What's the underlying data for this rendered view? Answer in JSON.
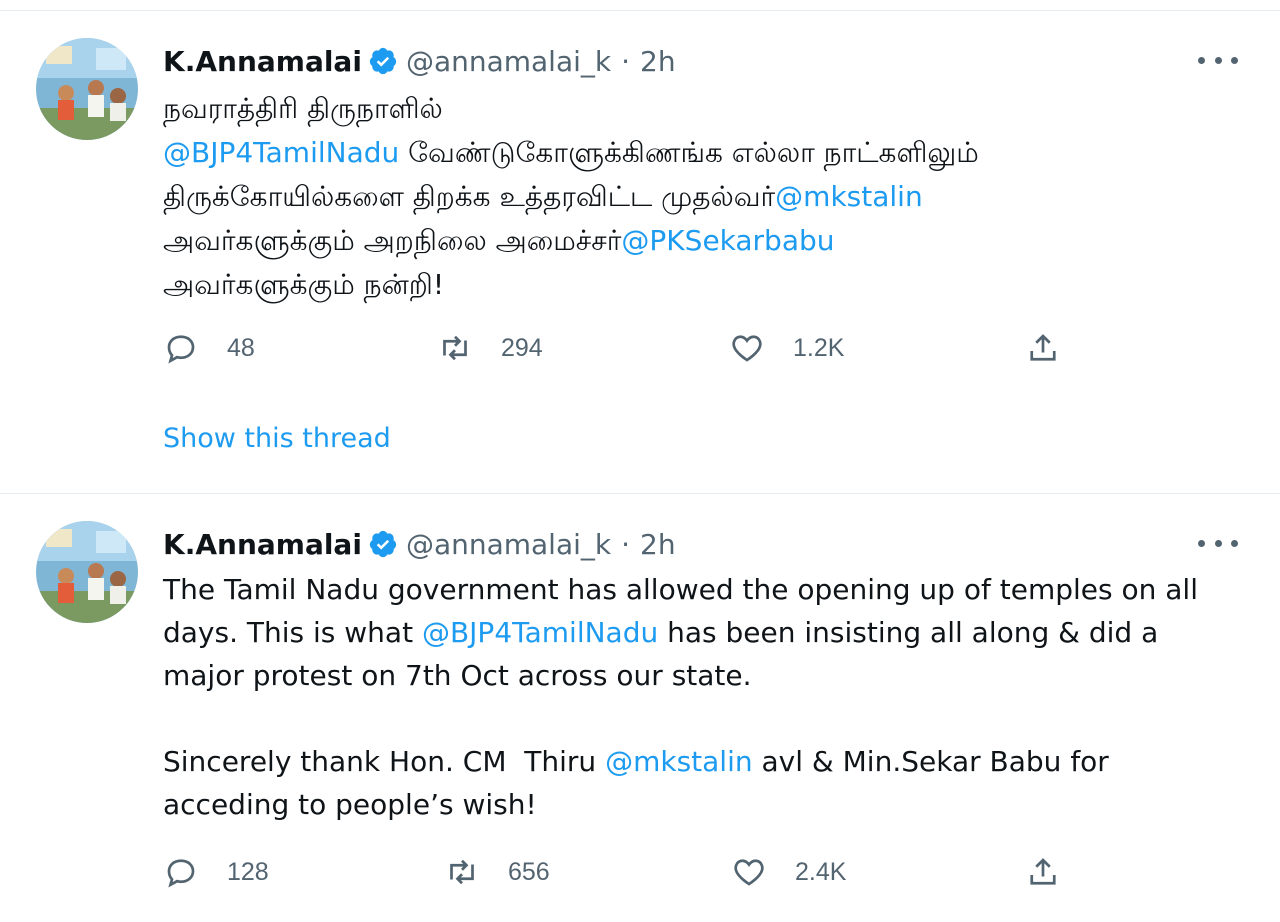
{
  "tweets": [
    {
      "name": "K.Annamalai",
      "handle": "@annamalai_k",
      "separator": "·",
      "time": "2h",
      "lines": [
        [
          {
            "t": "நவராத்திரி திருநாளில்"
          }
        ],
        [
          {
            "t": "@BJP4TamilNadu",
            "m": true
          },
          {
            "t": " வேண்டுகோளுக்கிணங்க எல்லா நாட்களிலும்"
          }
        ],
        [
          {
            "t": "திருக்கோயில்களை திறக்க உத்தரவிட்ட முதல்வர்"
          },
          {
            "t": "@mkstalin",
            "m": true
          }
        ],
        [
          {
            "t": "அவர்களுக்கும் அறநிலை அமைச்சர்"
          },
          {
            "t": "@PKSekarbabu",
            "m": true
          }
        ],
        [
          {
            "t": "அவர்களுக்கும் நன்றி!"
          }
        ]
      ],
      "replies": "48",
      "retweets": "294",
      "likes": "1.2K",
      "show_thread": "Show this thread",
      "icons": [
        "reply-icon",
        "retweet-icon",
        "like-icon",
        "share-icon",
        "verified-badge-icon",
        "more-options-icon"
      ]
    },
    {
      "name": "K.Annamalai",
      "handle": "@annamalai_k",
      "separator": "·",
      "time": "2h",
      "lines": [
        [
          {
            "t": "The Tamil Nadu government has allowed the opening up of temples on all"
          }
        ],
        [
          {
            "t": "days. This is what "
          },
          {
            "t": "@BJP4TamilNadu",
            "m": true
          },
          {
            "t": " has been insisting all along & did a"
          }
        ],
        [
          {
            "t": "major protest on 7th Oct across our state."
          }
        ],
        [
          {
            "t": ""
          }
        ],
        [
          {
            "t": "Sincerely thank Hon. CM  Thiru "
          },
          {
            "t": "@mkstalin",
            "m": true
          },
          {
            "t": " avl & Min.Sekar Babu for"
          }
        ],
        [
          {
            "t": "acceding to people’s wish!"
          }
        ]
      ],
      "replies": "128",
      "retweets": "656",
      "likes": "2.4K"
    }
  ],
  "colors": {
    "accent": "#1d9bf0",
    "text": "#0f1419",
    "secondary": "#536471",
    "border": "#e6ecf0"
  }
}
